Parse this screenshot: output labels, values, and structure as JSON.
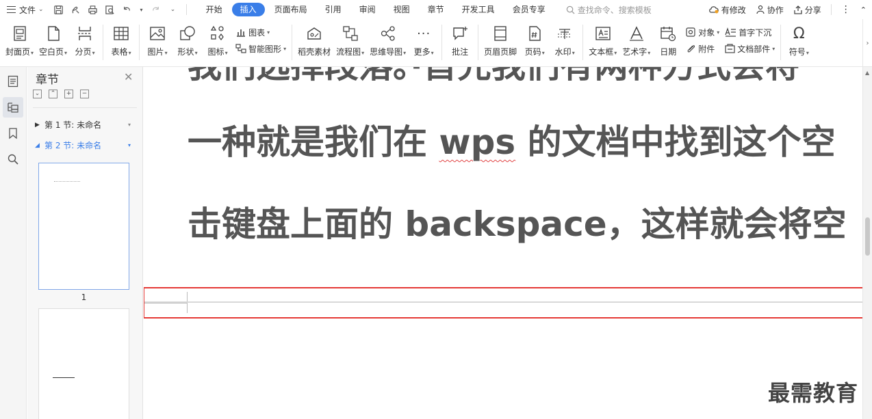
{
  "menubar": {
    "file_label": "文件",
    "tabs": [
      {
        "label": "开始",
        "active": false
      },
      {
        "label": "插入",
        "active": true
      },
      {
        "label": "页面布局",
        "active": false
      },
      {
        "label": "引用",
        "active": false
      },
      {
        "label": "审阅",
        "active": false
      },
      {
        "label": "视图",
        "active": false
      },
      {
        "label": "章节",
        "active": false
      },
      {
        "label": "开发工具",
        "active": false
      },
      {
        "label": "会员专享",
        "active": false
      }
    ],
    "search_placeholder": "查找命令、搜索模板",
    "right": {
      "modified_label": "有修改",
      "collab_label": "协作",
      "share_label": "分享"
    },
    "accent_color": "#3a7ee8"
  },
  "ribbon": {
    "cover_page": "封面页",
    "blank_page": "空白页",
    "page_break": "分页",
    "table": "表格",
    "picture": "图片",
    "shape": "形状",
    "icon": "图标",
    "chart": "图表",
    "smart_art": "智能图形",
    "docer_material": "稻壳素材",
    "flowchart": "流程图",
    "mind_map": "思维导图",
    "more": "更多",
    "comment": "批注",
    "header_footer": "页眉页脚",
    "page_number": "页码",
    "watermark": "水印",
    "text_box": "文本框",
    "word_art": "艺术字",
    "date": "日期",
    "object": "对象",
    "drop_cap": "首字下沉",
    "attachment": "附件",
    "doc_parts": "文档部件",
    "symbol": "符号"
  },
  "navpane": {
    "title": "章节",
    "sections": [
      {
        "label": "第 1 节: 未命名",
        "expanded": false,
        "selected": false
      },
      {
        "label": "第 2 节: 未命名",
        "expanded": true,
        "selected": true
      }
    ],
    "page1_number": "1"
  },
  "document": {
    "line0": "我们选择段落。·首先我们有两种方式会将",
    "line1_pre": "一种就是我们在 ",
    "line1_err": "wps",
    "line1_post": " 的文档中找到这个空",
    "line2": "击键盘上面的 backspace，这样就会将空",
    "watermark": "最需教育",
    "highlight_color": "#e53935"
  }
}
